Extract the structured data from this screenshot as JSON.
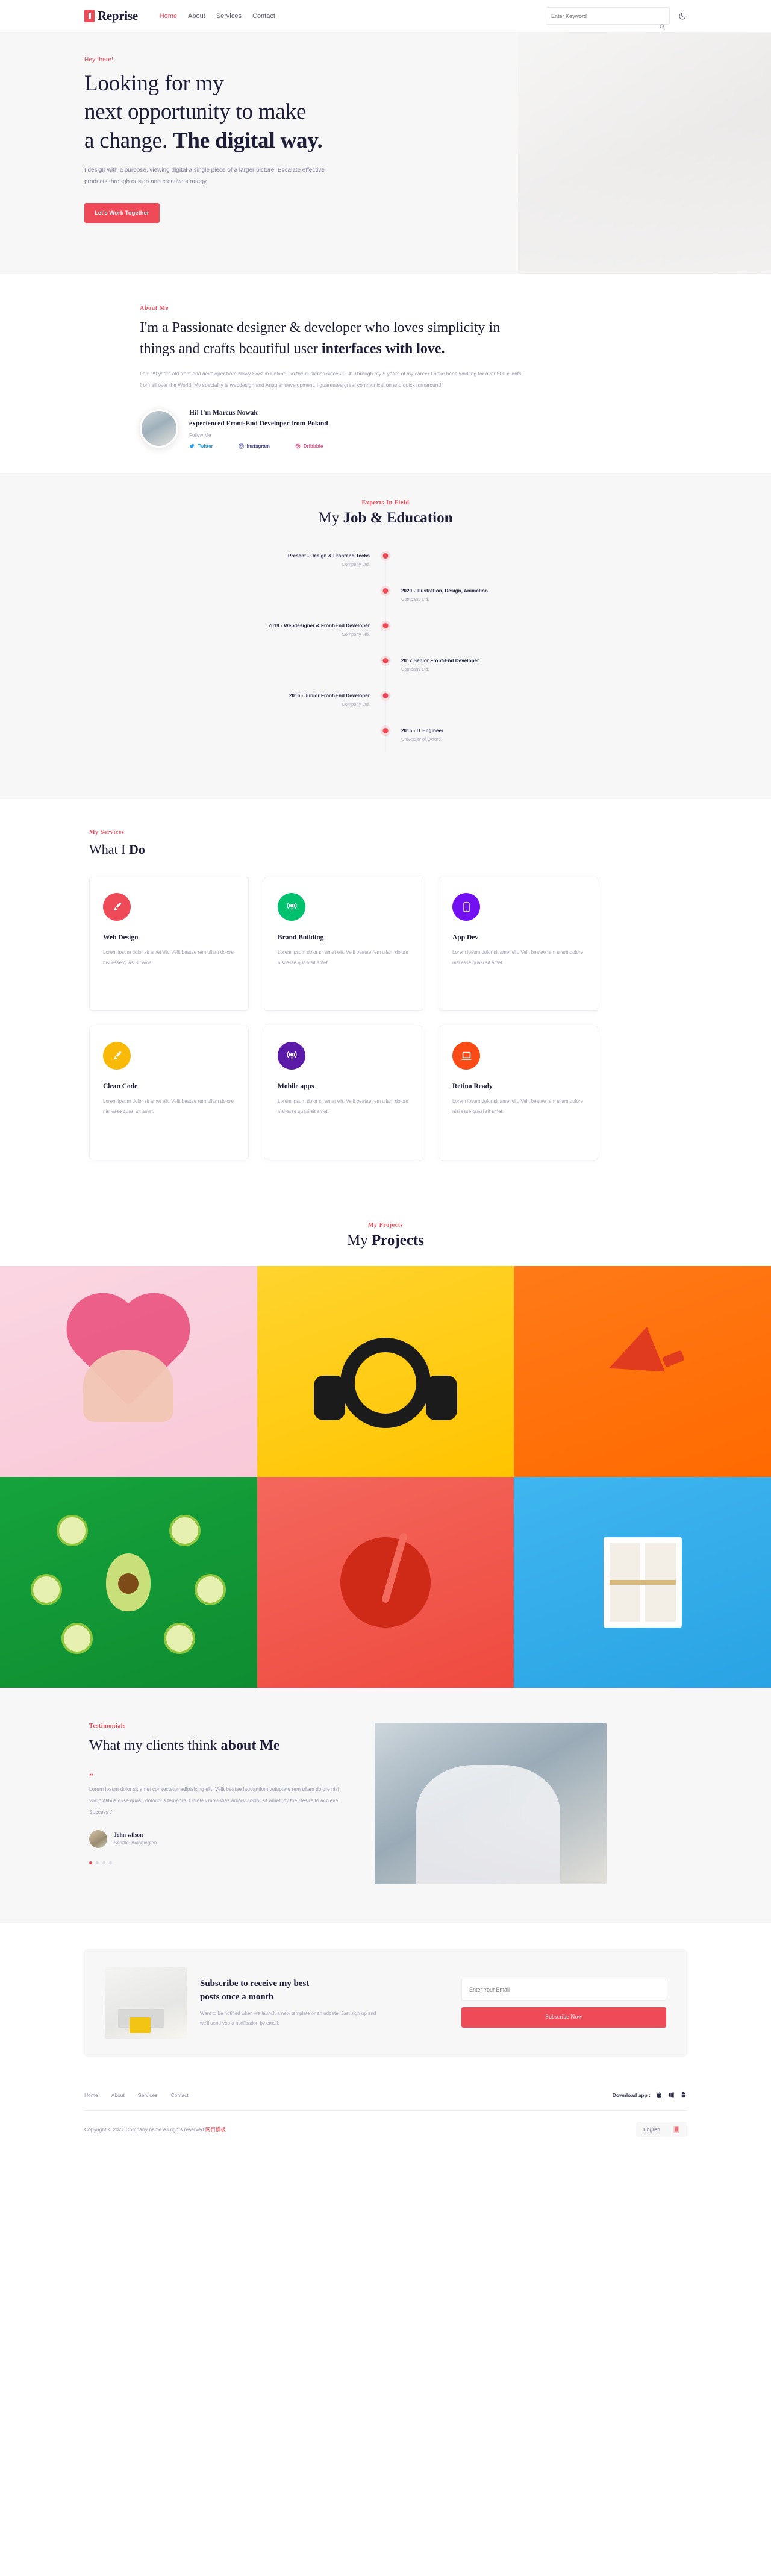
{
  "header": {
    "brand": "Reprise",
    "nav": [
      {
        "label": "Home",
        "active": true
      },
      {
        "label": "About",
        "active": false
      },
      {
        "label": "Services",
        "active": false
      },
      {
        "label": "Contact",
        "active": false
      }
    ],
    "search_placeholder": "Enter Keyword",
    "search_value": "",
    "theme_toggle": "moon-icon"
  },
  "hero": {
    "eyebrow": "Hey there!",
    "title_line1": "Looking for my",
    "title_line2": "next opportunity to make",
    "title_line3_plain": "a change. ",
    "title_line3_bold": "The digital way.",
    "paragraph": "I design with a purpose, viewing digital a single piece of a larger picture. Escalate effective products through design and creative strategy.",
    "cta": "Let's Work Together"
  },
  "about": {
    "eyebrow": "About Me",
    "heading_plain": "I'm a Passionate designer & developer who loves simplicity in things and crafts beautiful user ",
    "heading_bold": "interfaces with love.",
    "paragraph": "I am 29 years old front-end developer from Nowy Sacz in Poland - in the busienss since 2004! Through my 5 years of my career I have been working for over 500 clients from all over the World. My speciality is webdesign and Angular development. I guarentee great communication and quick turnaround.",
    "author_line1": "Hi! I'm Marcus Nowak",
    "author_line2": "experienced Front-End Developer from Poland",
    "follow_label": "Follow Me",
    "socials": [
      {
        "label": "Twitter",
        "icon": "twitter-icon"
      },
      {
        "label": "Instagram",
        "icon": "instagram-icon"
      },
      {
        "label": "Dribbble",
        "icon": "dribbble-icon"
      }
    ]
  },
  "timeline": {
    "eyebrow": "Experts In Field",
    "title_plain": "My ",
    "title_bold": "Job & Education",
    "items": [
      {
        "side": "left",
        "title": "Present - Design & Frontend Techs",
        "sub": "Company Ltd."
      },
      {
        "side": "right",
        "title": "2020 - Illustration, Design, Animation",
        "sub": "Company Ltd."
      },
      {
        "side": "left",
        "title": "2019 - Webdesigner & Front-End Developer",
        "sub": "Company Ltd."
      },
      {
        "side": "right",
        "title": "2017 Senior Front-End Developer",
        "sub": "Company Ltd."
      },
      {
        "side": "left",
        "title": "2016 - Junior Front-End Developer",
        "sub": "Company Ltd."
      },
      {
        "side": "right",
        "title": "2015 - IT Engineer",
        "sub": "University of Oxford"
      }
    ]
  },
  "services": {
    "eyebrow": "My Services",
    "title_plain": "What I ",
    "title_bold": "Do",
    "description": "Lorem ipsum dolor sit amet elit. Velit beatae rem ullam dolore nisi esse quasi sit amet.",
    "cards": [
      {
        "title": "Web Design",
        "icon": "brush-icon",
        "color": "#ef4a58",
        "desc": "Lorem ipsum dolor sit amet elit. Velit beatae rem ullam dolore nisi esse quasi sit amet."
      },
      {
        "title": "Brand Building",
        "icon": "podcast-icon",
        "color": "#00c16e",
        "desc": "Lorem ipsum dolor sit amet elit. Velit beatae rem ullam dolore nisi esse quasi sit amet."
      },
      {
        "title": "App Dev",
        "icon": "mobile-icon",
        "color": "#7310f2",
        "desc": "Lorem ipsum dolor sit amet elit. Velit beatae rem ullam dolore nisi esse quasi sit amet."
      },
      {
        "title": "Clean Code",
        "icon": "brush-icon",
        "color": "#f8b908",
        "desc": "Lorem ipsum dolor sit amet elit. Velit beatae rem ullam dolore nisi esse quasi sit amet."
      },
      {
        "title": "Mobile apps",
        "icon": "podcast-icon",
        "color": "#5b1aa8",
        "desc": "Lorem ipsum dolor sit amet elit. Velit beatae rem ullam dolore nisi esse quasi sit amet."
      },
      {
        "title": "Retina Ready",
        "icon": "laptop-icon",
        "color": "#fa4b16",
        "desc": "Lorem ipsum dolor sit amet elit. Velit beatae rem ullam dolore nisi esse quasi sit amet."
      }
    ]
  },
  "projects": {
    "eyebrow": "My Projects",
    "title_plain": "My ",
    "title_bold": "Projects",
    "tiles": [
      {
        "name": "flowers-in-hands",
        "bg": "#fbd6e2"
      },
      {
        "name": "headphones",
        "bg": "#ffd42e"
      },
      {
        "name": "megaphone",
        "bg": "#ff7a18"
      },
      {
        "name": "avocado-kiwi",
        "bg": "#15a33c"
      },
      {
        "name": "red-drink",
        "bg": "#f4675c"
      },
      {
        "name": "window-model",
        "bg": "#3fb6f0"
      }
    ]
  },
  "testimonials": {
    "eyebrow": "Testimonials",
    "title_plain": "What my clients think ",
    "title_bold": "about Me",
    "quote_mark": "”",
    "quote": "Lorem ipsum dolor sit amet consectetur adipisicing elit. Velit beatae laudantium voluptate rem ullam dolore nisi voluptatibus esse quasi, doloribus tempora. Dolores molestias adipisci dolor sit amet! by the Desire to achieve Success .\"",
    "person_name": "John wilson",
    "person_location": "Seattle, Washington",
    "dots_total": 4,
    "dots_active_index": 0
  },
  "subscribe": {
    "heading_line1": "Subscribe to receive my best",
    "heading_line2": "posts once a month",
    "paragraph": "Want to be notified when we launch a new template or an udpate. Just sign up and we'll send you a notification by email.",
    "input_placeholder": "Enter Your Email",
    "input_value": "",
    "button": "Subscribe Now"
  },
  "footer": {
    "nav": [
      {
        "label": "Home"
      },
      {
        "label": "About"
      },
      {
        "label": "Services"
      },
      {
        "label": "Contact"
      }
    ],
    "download_label": "Download app :",
    "download_icons": [
      "apple-icon",
      "windows-icon",
      "android-icon"
    ],
    "copyright": "Copyright © 2021.Company name All rights reserved.",
    "copyright_cn": "网页模板",
    "language": "English",
    "language_flag": "flag-icon"
  },
  "colors": {
    "accent": "#ef4a58",
    "dark": "#1d1d38",
    "muted": "#a2a2b4",
    "section_bg": "#f7f7f8"
  }
}
